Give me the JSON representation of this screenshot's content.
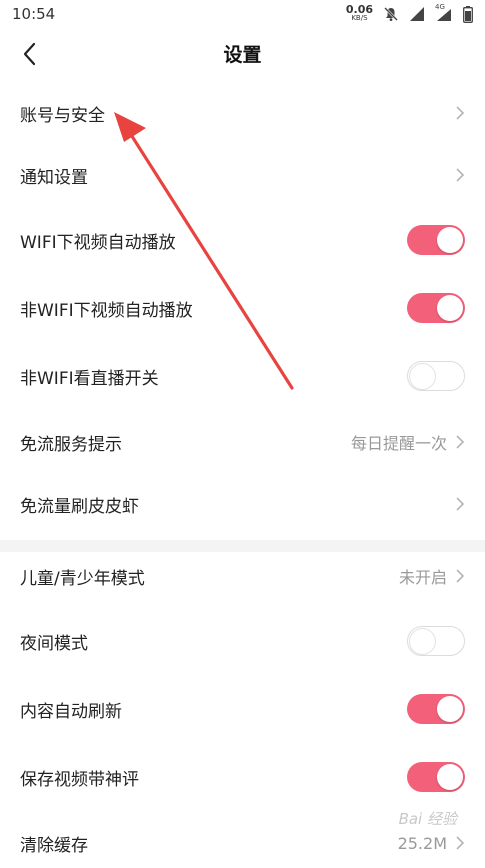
{
  "status_bar": {
    "time": "10:54",
    "net_speed_value": "0.06",
    "net_speed_unit": "KB/S",
    "network_label": "4G",
    "icons": [
      "mute-icon",
      "signal-icon",
      "signal-4g-icon",
      "battery-icon"
    ]
  },
  "header": {
    "back_icon": "chevron-left-icon",
    "title": "设置"
  },
  "section1": {
    "items": [
      {
        "label": "账号与安全",
        "type": "link",
        "value": ""
      },
      {
        "label": "通知设置",
        "type": "link",
        "value": ""
      },
      {
        "label": "WIFI下视频自动播放",
        "type": "toggle",
        "on": true
      },
      {
        "label": "非WIFI下视频自动播放",
        "type": "toggle",
        "on": true
      },
      {
        "label": "非WIFI看直播开关",
        "type": "toggle",
        "on": false
      },
      {
        "label": "免流服务提示",
        "type": "link",
        "value": "每日提醒一次"
      },
      {
        "label": "免流量刷皮皮虾",
        "type": "link",
        "value": ""
      }
    ]
  },
  "section2": {
    "items": [
      {
        "label": "儿童/青少年模式",
        "type": "link",
        "value": "未开启"
      },
      {
        "label": "夜间模式",
        "type": "toggle",
        "on": false
      },
      {
        "label": "内容自动刷新",
        "type": "toggle",
        "on": true
      },
      {
        "label": "保存视频带神评",
        "type": "toggle",
        "on": true
      },
      {
        "label": "清除缓存",
        "type": "link",
        "value": "25.2M"
      }
    ]
  },
  "colors": {
    "toggle_on": "#f2607a",
    "annotation_arrow": "#e8433f"
  },
  "watermark": "Bai 经验"
}
